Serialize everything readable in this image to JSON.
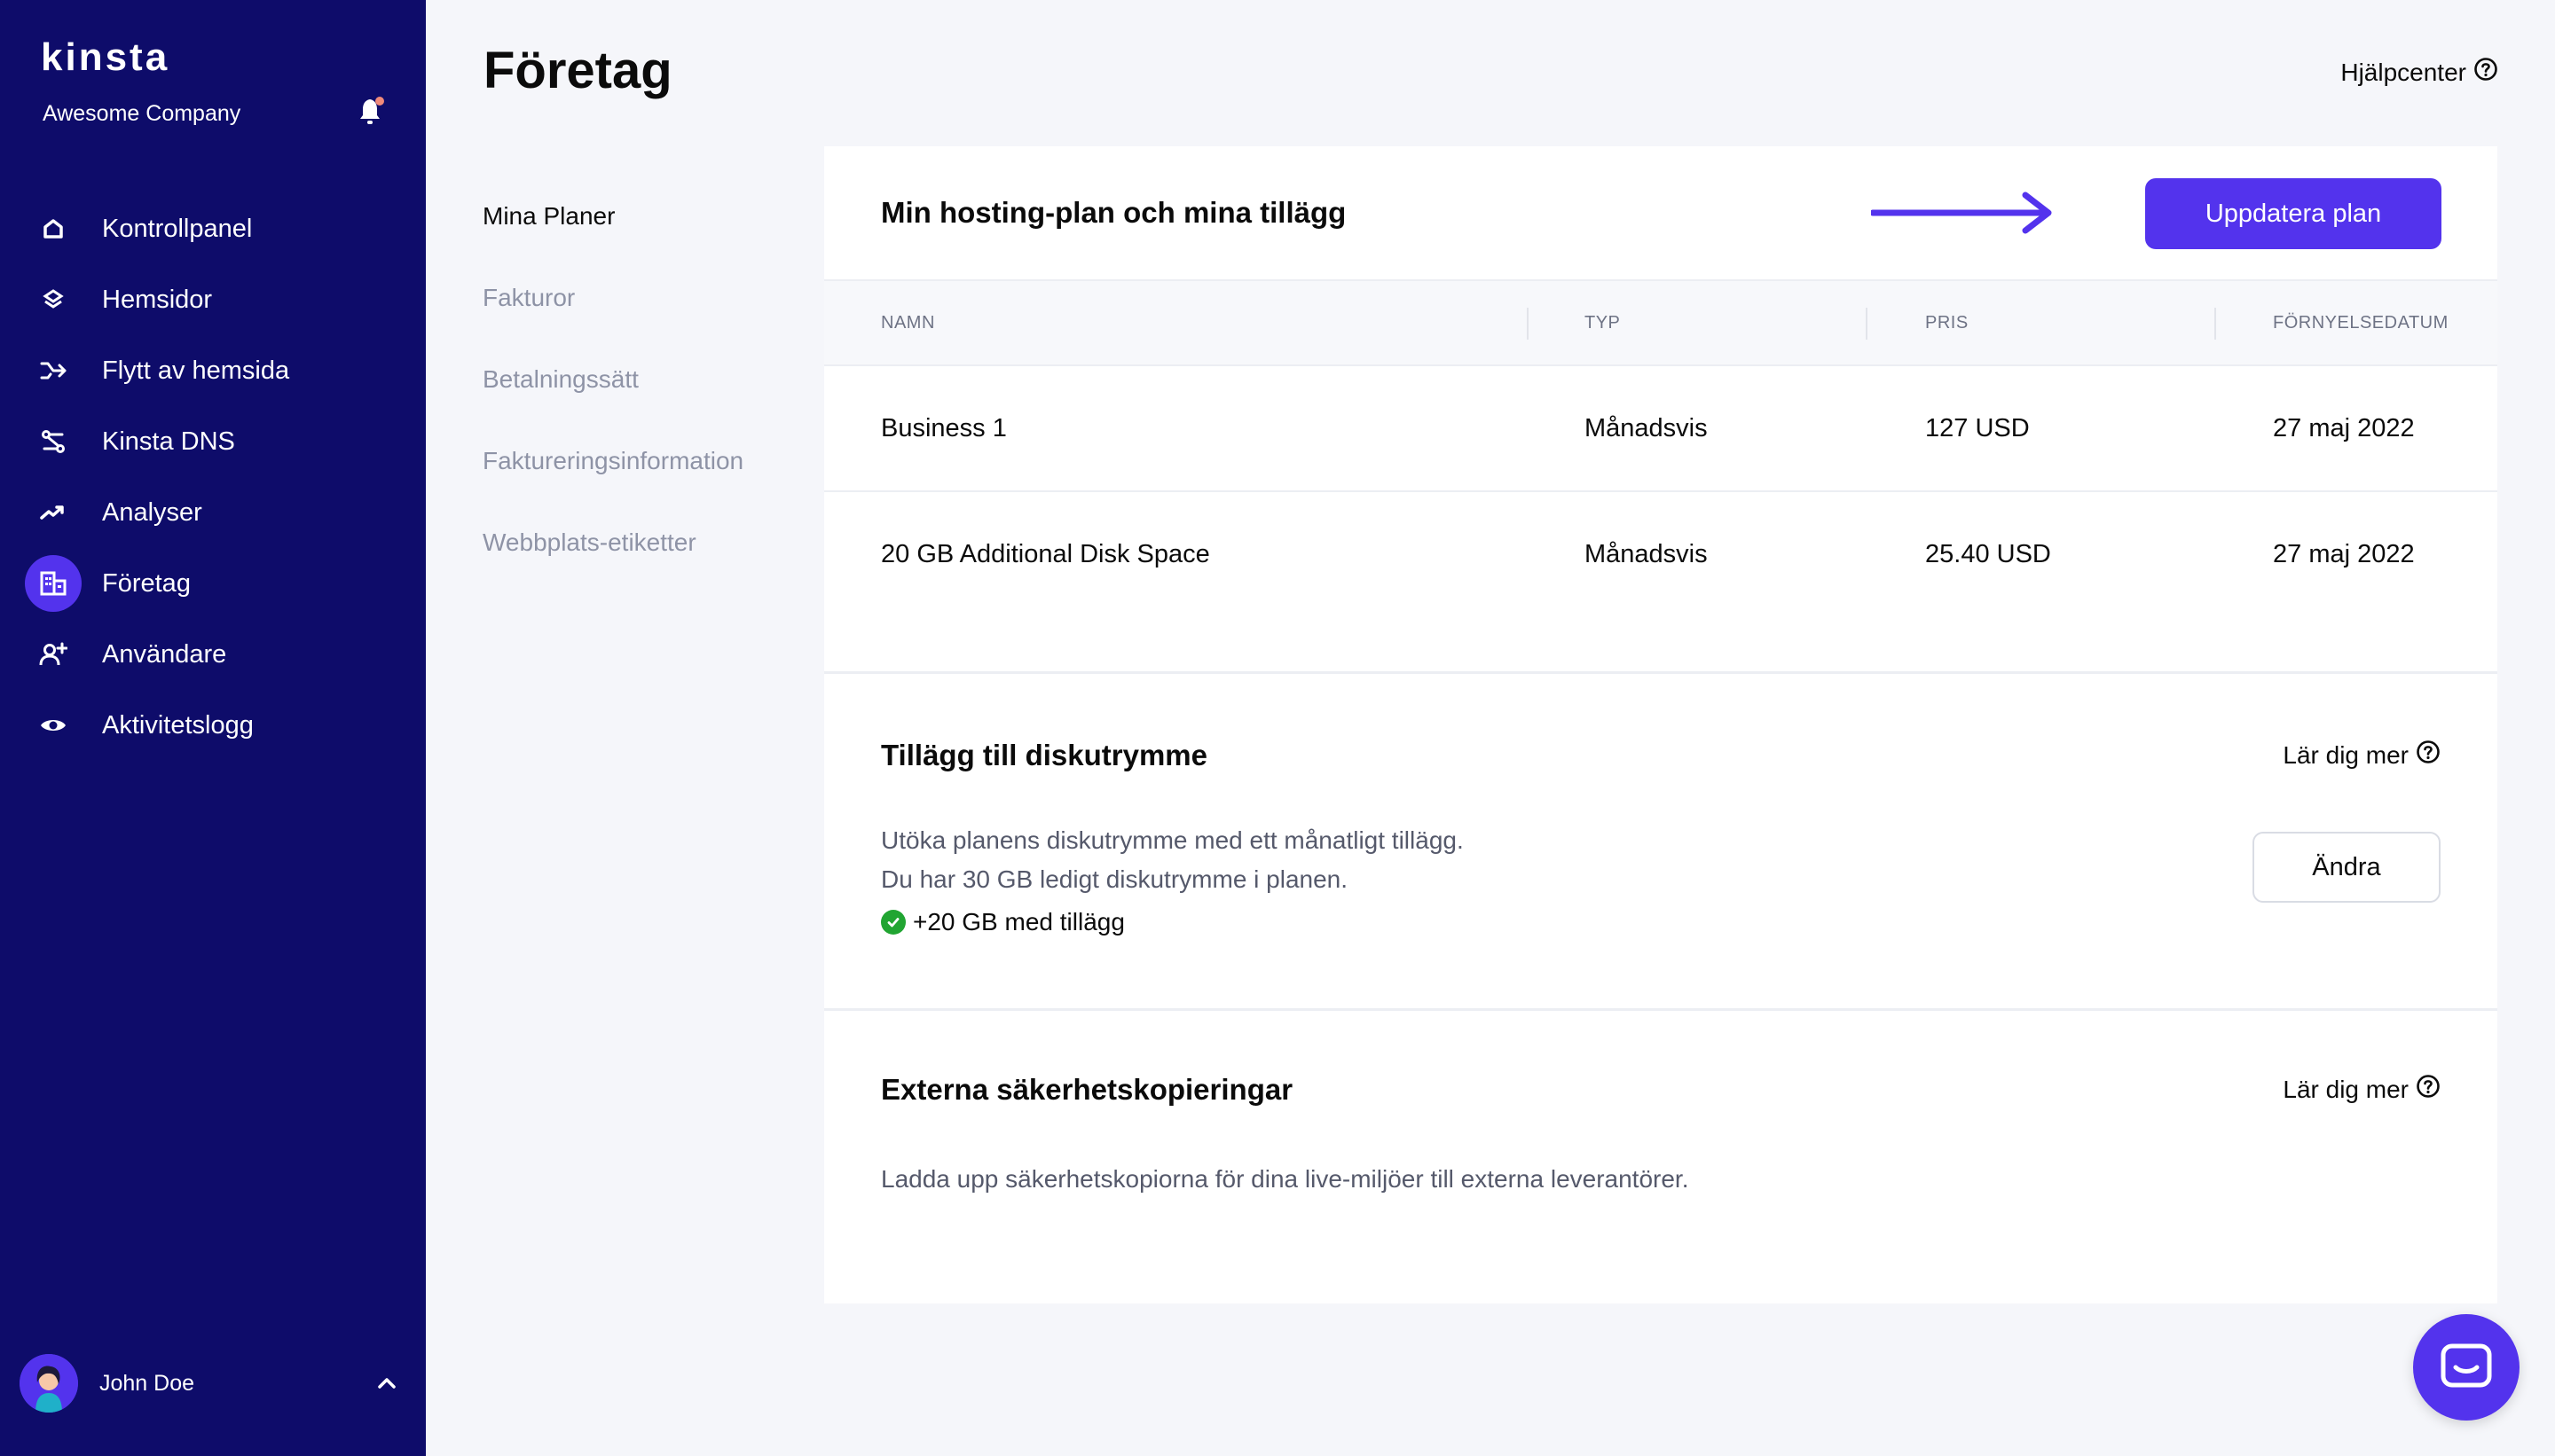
{
  "sidebar": {
    "logo": "kinsta",
    "company": "Awesome Company",
    "items": [
      {
        "label": "Kontrollpanel",
        "icon": "home-icon"
      },
      {
        "label": "Hemsidor",
        "icon": "layers-icon"
      },
      {
        "label": "Flytt av hemsida",
        "icon": "migration-icon"
      },
      {
        "label": "Kinsta DNS",
        "icon": "dns-icon"
      },
      {
        "label": "Analyser",
        "icon": "trend-icon"
      },
      {
        "label": "Företag",
        "icon": "building-icon",
        "active": true
      },
      {
        "label": "Användare",
        "icon": "add-user-icon"
      },
      {
        "label": "Aktivitetslogg",
        "icon": "eye-icon"
      }
    ],
    "user": {
      "name": "John Doe"
    }
  },
  "header": {
    "title": "Företag",
    "help": "Hjälpcenter"
  },
  "subnav": {
    "items": [
      {
        "label": "Mina Planer",
        "active": true
      },
      {
        "label": "Fakturor"
      },
      {
        "label": "Betalningssätt"
      },
      {
        "label": "Faktureringsinformation"
      },
      {
        "label": "Webbplats-etiketter"
      }
    ]
  },
  "plan": {
    "title": "Min hosting-plan och mina tillägg",
    "update_button": "Uppdatera plan",
    "columns": [
      "NAMN",
      "TYP",
      "PRIS",
      "FÖRNYELSEDATUM"
    ],
    "rows": [
      {
        "name": "Business 1",
        "type": "Månadsvis",
        "price": "127 USD",
        "renewal": "27 maj 2022"
      },
      {
        "name": "20 GB Additional Disk Space",
        "type": "Månadsvis",
        "price": "25.40 USD",
        "renewal": "27 maj 2022"
      }
    ]
  },
  "disk": {
    "title": "Tillägg till diskutrymme",
    "learn_more": "Lär dig mer",
    "line1": "Utöka planens diskutrymme med ett månatligt tillägg.",
    "line2": "Du har 30 GB ledigt diskutrymme i planen.",
    "status": "+20 GB med tillägg",
    "button": "Ändra"
  },
  "backups": {
    "title": "Externa säkerhetskopieringar",
    "learn_more": "Lär dig mer",
    "text": "Ladda upp säkerhetskopiorna för dina live-miljöer till externa leverantörer."
  },
  "colors": {
    "sidebar": "#0E0C6A",
    "accent": "#5333ED",
    "success": "#21A532"
  }
}
